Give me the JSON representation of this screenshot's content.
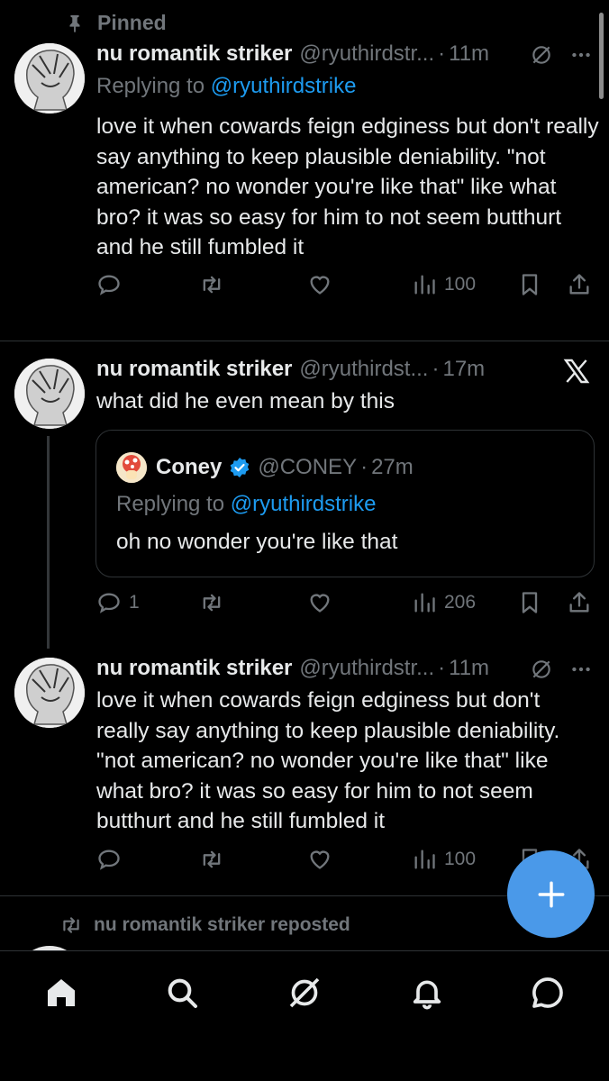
{
  "pinned_label": "Pinned",
  "tweets": [
    {
      "name": "nu romantik striker",
      "handle": "@ryuthirdstr...",
      "dot": "·",
      "time": "11m",
      "replying_prefix": "Replying to ",
      "replying_handle": "@ryuthirdstrike",
      "text": "love it when cowards feign edginess but don't really say anything to keep plausible deniability. \"not american? no wonder you're like that\" like what bro? it was so easy for him to not seem butthurt and he still fumbled it",
      "views": "100"
    },
    {
      "name": "nu romantik striker",
      "handle": "@ryuthirdst...",
      "dot": "·",
      "time": "17m",
      "text": "what did he even mean by this",
      "replies": "1",
      "views": "206",
      "quote": {
        "name": "Coney",
        "handle": "@CONEY",
        "dot": "·",
        "time": "27m",
        "replying_prefix": "Replying to ",
        "replying_handle": "@ryuthirdstrike",
        "text": "oh no wonder you're like that"
      }
    },
    {
      "name": "nu romantik striker",
      "handle": "@ryuthirdstr...",
      "dot": "·",
      "time": "11m",
      "text": "love it when cowards feign edginess but don't really say anything to keep plausible deniability. \"not american? no wonder you're like that\" like what bro? it was so easy for him to not seem butthurt and he still fumbled it",
      "views": "100"
    }
  ],
  "repost_label": "nu romantik striker reposted",
  "colors": {
    "background": "#000000",
    "text": "#e7e9ea",
    "muted": "#71767b",
    "link": "#1d9bf0",
    "fab": "#4a99e9"
  },
  "nav": [
    "home-icon",
    "search-icon",
    "grok-icon",
    "notifications-icon",
    "messages-icon"
  ]
}
